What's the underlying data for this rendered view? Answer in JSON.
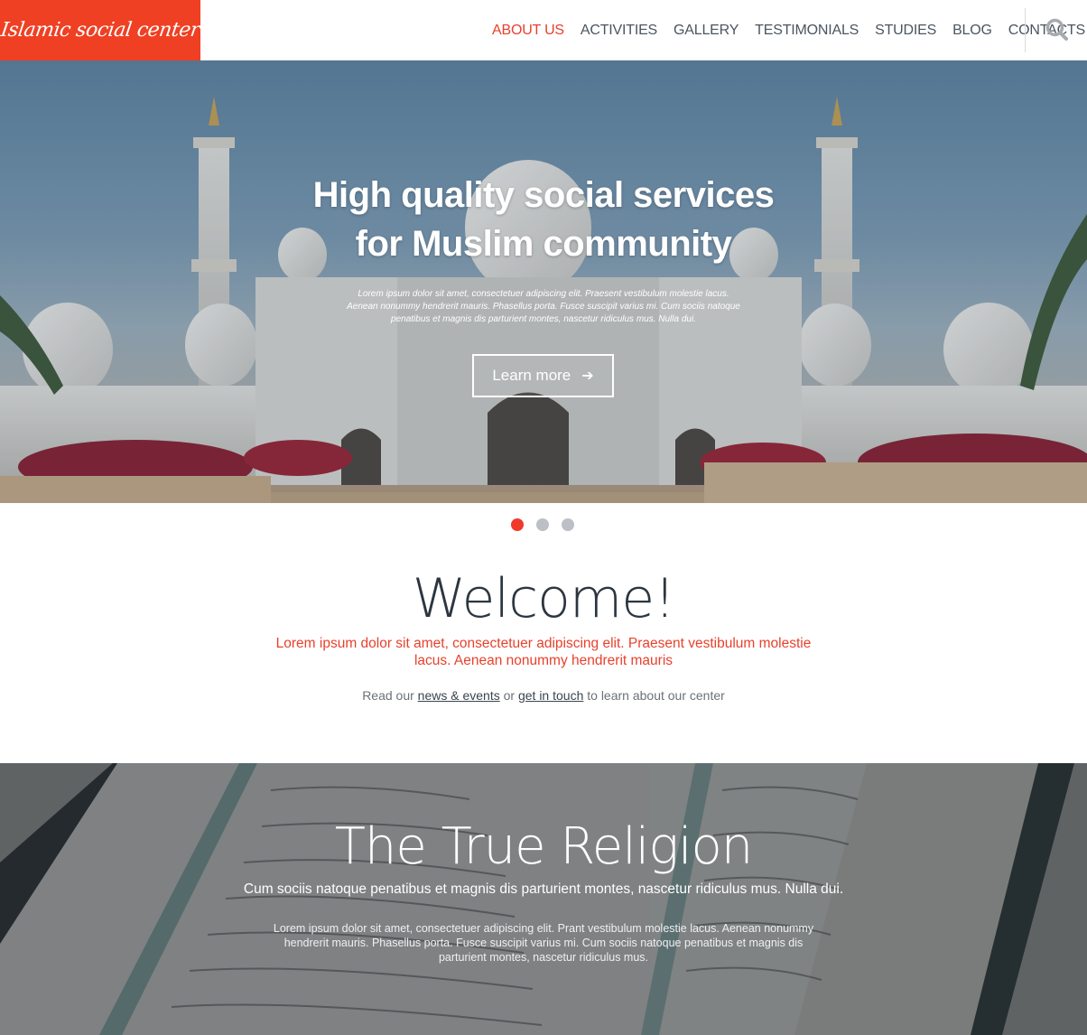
{
  "header": {
    "logo_text": "Islamic social center",
    "nav": [
      {
        "label": "ABOUT US",
        "active": true
      },
      {
        "label": "ACTIVITIES",
        "active": false
      },
      {
        "label": "GALLERY",
        "active": false
      },
      {
        "label": "TESTIMONIALS",
        "active": false
      },
      {
        "label": "STUDIES",
        "active": false
      },
      {
        "label": "BLOG",
        "active": false
      },
      {
        "label": "CONTACTS",
        "active": false
      }
    ],
    "search_icon": "search-icon"
  },
  "hero": {
    "title_line1": "High quality social services",
    "title_line2": "for Muslim community",
    "text": "Lorem ipsum dolor sit amet, consectetuer adipiscing elit. Praesent vestibulum molestie lacus. Aenean nonummy hendrerit mauris. Phasellus porta. Fusce suscipit varius mi. Cum sociis natoque penatibus et magnis dis parturient montes, nascetur ridiculus mus. Nulla dui.",
    "button_label": "Learn more",
    "button_icon": "arrow-right-icon",
    "slides_total": 3,
    "active_slide": 1
  },
  "welcome": {
    "title": "Welcome!",
    "lead": "Lorem ipsum dolor sit amet, consectetuer adipiscing elit. Praesent vestibulum molestie lacus. Aenean nonummy hendrerit mauris",
    "note_prefix": "Read our",
    "link1": "news & events",
    "note_middle": "or",
    "link2": "get in touch",
    "note_suffix": "to learn about our center"
  },
  "religion": {
    "title": "The True Religion",
    "subtitle": "Cum sociis natoque penatibus et magnis dis parturient montes, nascetur ridiculus mus. Nulla dui.",
    "text": "Lorem ipsum dolor sit amet, consectetuer adipiscing elit. Prant vestibulum molestie lacus. Aenean nonummy hendrerit mauris. Phasellus porta. Fusce suscipit varius mi. Cum sociis natoque penatibus et magnis dis parturient montes, nascetur ridiculus mus."
  },
  "colors": {
    "brand": "#ef4023",
    "nav_active": "#e8412c",
    "nav_text": "#4b5560",
    "dot_inactive": "#bcbfc6"
  }
}
